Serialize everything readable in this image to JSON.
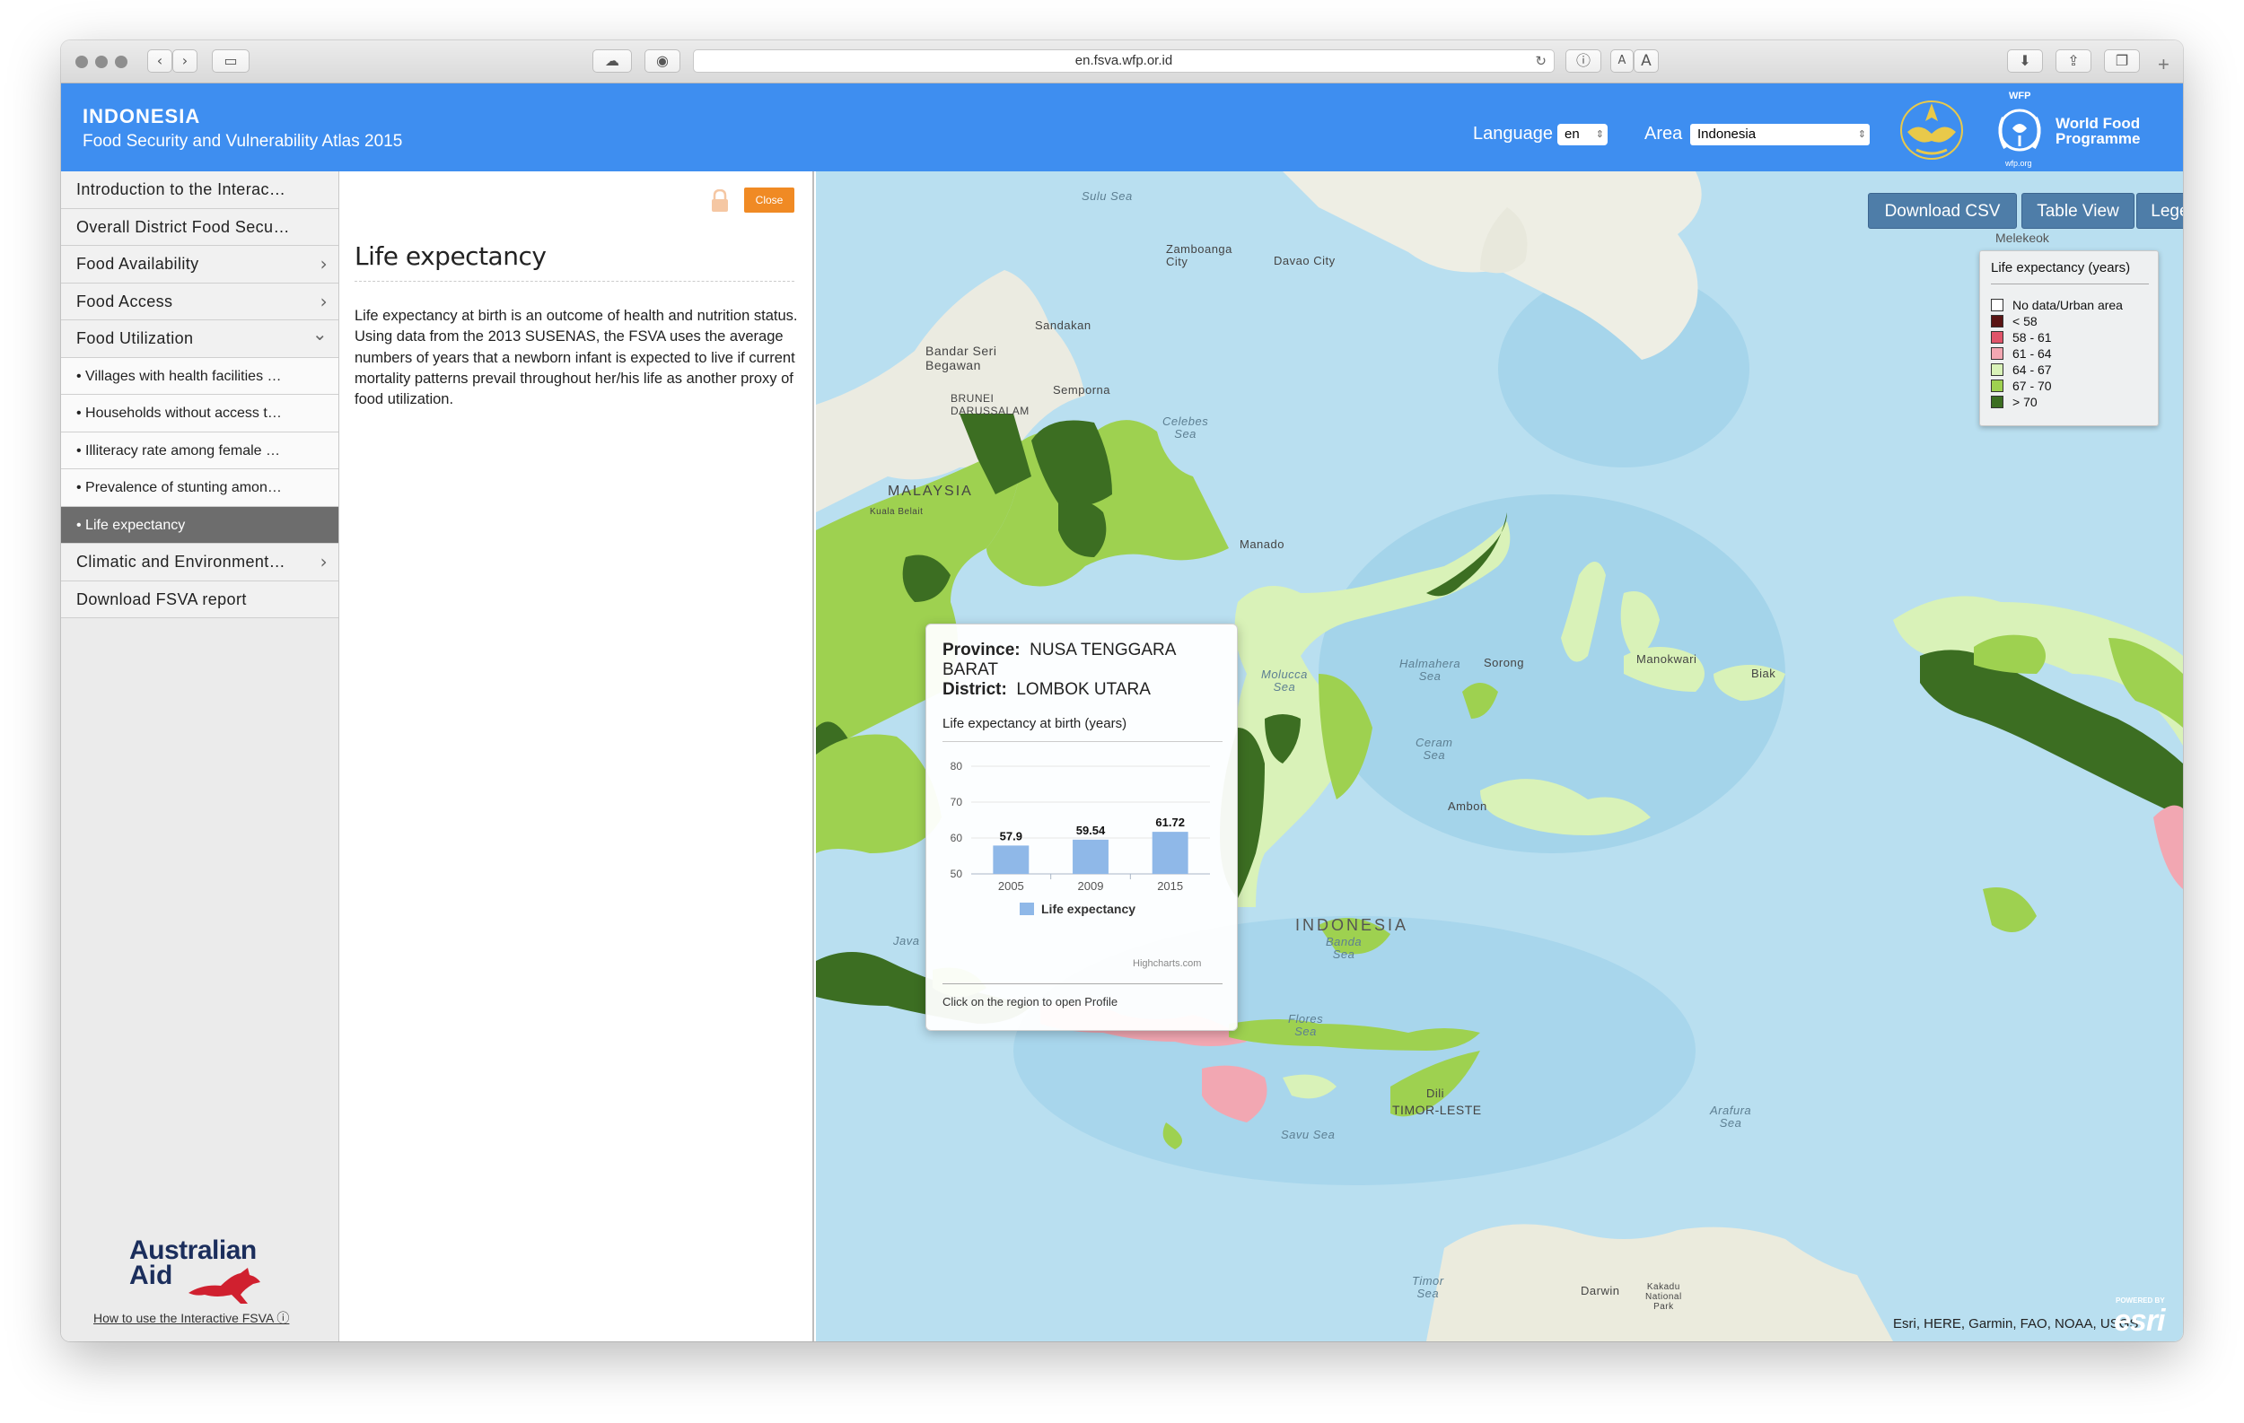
{
  "browser": {
    "url": "en.fsva.wfp.or.id"
  },
  "header": {
    "country": "INDONESIA",
    "subtitle": "Food Security and Vulnerability Atlas 2015",
    "language_label": "Language",
    "language_value": "en",
    "area_label": "Area",
    "area_value": "Indonesia",
    "wfp_small": "WFP",
    "wfp_name_line1": "World Food",
    "wfp_name_line2": "Programme",
    "wfp_org": "wfp.org"
  },
  "sidebar": {
    "items": [
      {
        "label": "Introduction to the Interac…",
        "chevron": ""
      },
      {
        "label": "Overall District Food Secu…",
        "chevron": ""
      },
      {
        "label": "Food Availability",
        "chevron": "›"
      },
      {
        "label": "Food Access",
        "chevron": "›"
      },
      {
        "label": "Food Utilization",
        "chevron": "⌄"
      },
      {
        "label": "• Villages with health facilities …",
        "chevron": ""
      },
      {
        "label": "• Households without access t…",
        "chevron": ""
      },
      {
        "label": "• Illiteracy rate among female …",
        "chevron": ""
      },
      {
        "label": "• Prevalence of stunting amon…",
        "chevron": ""
      },
      {
        "label": "• Life expectancy",
        "chevron": ""
      },
      {
        "label": "Climatic and Environment…",
        "chevron": "›"
      },
      {
        "label": "Download FSVA report",
        "chevron": ""
      }
    ],
    "aus_line1": "Australian",
    "aus_line2": "Aid",
    "how_to": "How to use the Interactive FSVA ⓘ"
  },
  "panel": {
    "close_label": "Close",
    "title": "Life expectancy",
    "description": "Life expectancy at birth is an outcome of health and nutrition status. Using data from the 2013 SUSENAS, the FSVA uses the average numbers of years that a newborn infant is expected to live if current mortality patterns prevail throughout her/his life as another proxy of food utilization."
  },
  "map": {
    "buttons": {
      "download_csv": "Download CSV",
      "table_view": "Table View",
      "legend": "Legend"
    },
    "melekeok": "Melekeok",
    "legend": {
      "title": "Life expectancy (years)",
      "items": [
        {
          "label": "No data/Urban area",
          "color": "#ffffff"
        },
        {
          "label": "< 58",
          "color": "#5a1414"
        },
        {
          "label": "58 - 61",
          "color": "#e0546a"
        },
        {
          "label": "61 - 64",
          "color": "#f2a7b2"
        },
        {
          "label": "64 - 67",
          "color": "#d9f2b8"
        },
        {
          "label": "67 - 70",
          "color": "#9ed150"
        },
        {
          "label": "> 70",
          "color": "#3c6e22"
        }
      ]
    },
    "labels": {
      "sulu_sea": "Sulu Sea",
      "zamboanga": "Zamboanga\nCity",
      "davao": "Davao City",
      "sandakan": "Sandakan",
      "bandar": "Bandar Seri\nBegawan",
      "brunei": "BRUNEI\nDARUSSALAM",
      "semporna": "Semporna",
      "celebes": "Celebes\nSea",
      "malaysia": "MALAYSIA",
      "kuala": "Kuala Belait",
      "manado": "Manado",
      "molucca": "Molucca\nSea",
      "halmahera": "Halmahera\nSea",
      "sorong": "Sorong",
      "manokwari": "Manokwari",
      "biak": "Biak",
      "ceram": "Ceram\nSea",
      "ambon": "Ambon",
      "banda": "Banda\nSea",
      "indonesia": "INDONESIA",
      "java": "Java",
      "flores": "Flores\nSea",
      "dili": "Dili",
      "timor_leste": "TIMOR-LESTE",
      "savu": "Savu Sea",
      "arafura": "Arafura\nSea",
      "timor_sea": "Timor\nSea",
      "darwin": "Darwin",
      "kakadu": "Kakadu\nNational\nPark"
    },
    "tooltip": {
      "province_label": "Province:",
      "province_value": "NUSA TENGGARA BARAT",
      "district_label": "District:",
      "district_value": "LOMBOK UTARA",
      "chart_title": "Life expectancy at birth (years)",
      "credit": "Highcharts.com",
      "footer": "Click on the region to open Profile"
    },
    "attribution": "Esri, HERE, Garmin, FAO, NOAA, USGS",
    "esri_powered": "POWERED BY",
    "esri": "esri"
  },
  "chart_data": {
    "type": "bar",
    "title": "Life expectancy at birth (years)",
    "categories": [
      "2005",
      "2009",
      "2015"
    ],
    "series": [
      {
        "name": "Life expectancy",
        "values": [
          57.9,
          59.54,
          61.72
        ],
        "color": "#8fb8e8"
      }
    ],
    "ylim": [
      50,
      80
    ],
    "yticks": [
      50,
      60,
      70,
      80
    ],
    "legend": "bottom"
  }
}
